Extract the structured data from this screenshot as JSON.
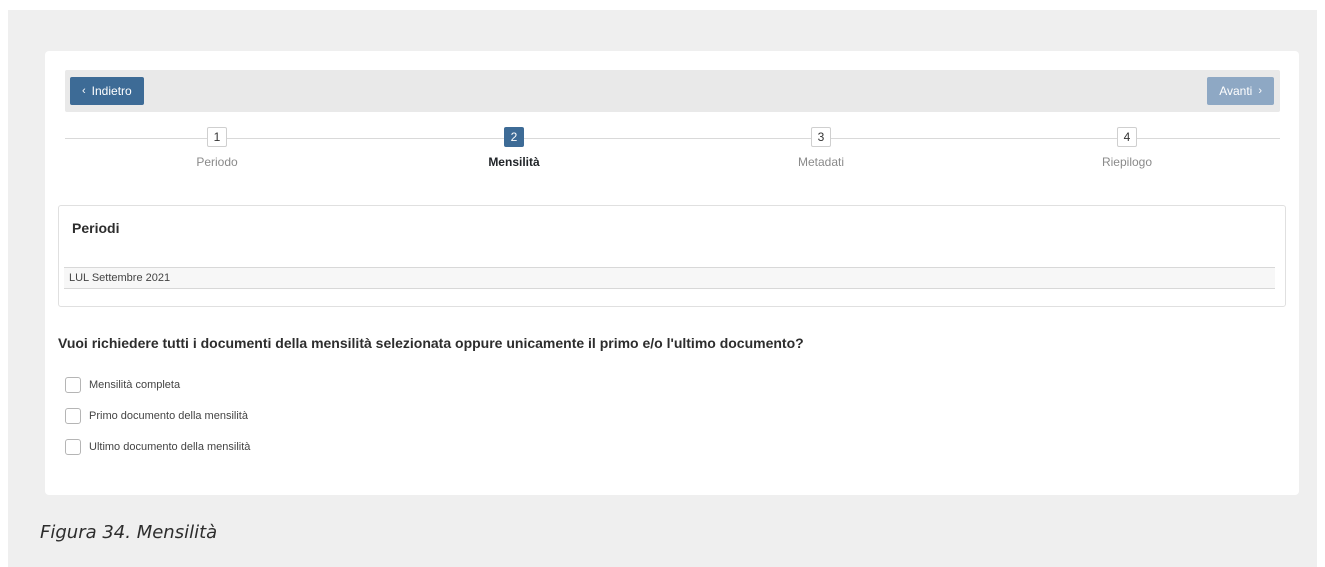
{
  "nav": {
    "back_label": "Indietro",
    "next_label": "Avanti"
  },
  "steps": [
    {
      "number": "1",
      "label": "Periodo",
      "active": false
    },
    {
      "number": "2",
      "label": "Mensilità",
      "active": true
    },
    {
      "number": "3",
      "label": "Metadati",
      "active": false
    },
    {
      "number": "4",
      "label": "Riepilogo",
      "active": false
    }
  ],
  "periodi": {
    "title": "Periodi",
    "items": [
      "LUL Settembre 2021"
    ]
  },
  "question": "Vuoi richiedere tutti i documenti della mensilità selezionata oppure unicamente il primo e/o l'ultimo documento?",
  "options": [
    {
      "label": "Mensilità completa",
      "checked": false
    },
    {
      "label": "Primo documento della mensilità",
      "checked": false
    },
    {
      "label": "Ultimo documento della mensilità",
      "checked": false
    }
  ],
  "caption": "Figura 34. Mensilità",
  "colors": {
    "primary": "#3d6b96",
    "primary_disabled": "#8ea8c4",
    "frame_bg": "#efefef"
  }
}
